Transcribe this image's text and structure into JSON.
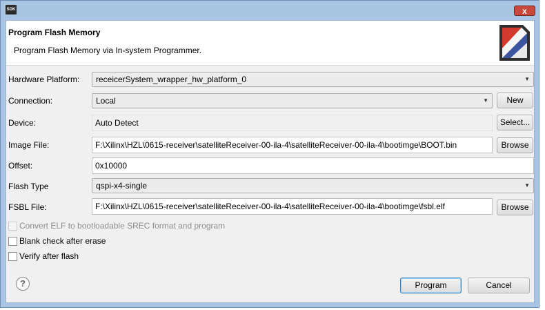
{
  "window": {
    "icon_text": "SDK",
    "close_glyph": "x"
  },
  "banner": {
    "title": "Program Flash Memory",
    "description": "Program Flash Memory via In-system Programmer."
  },
  "form": {
    "hardware_platform": {
      "label": "Hardware Platform:",
      "value": "receicerSystem_wrapper_hw_platform_0"
    },
    "connection": {
      "label": "Connection:",
      "value": "Local",
      "new_button": "New"
    },
    "device": {
      "label": "Device:",
      "value": "Auto Detect",
      "select_button": "Select..."
    },
    "image_file": {
      "label": "Image File:",
      "value": "F:\\Xilinx\\HZL\\0615-receiver\\satelliteReceiver-00-ila-4\\satelliteReceiver-00-ila-4\\bootimge\\BOOT.bin",
      "browse_button": "Browse"
    },
    "offset": {
      "label": "Offset:",
      "value": "0x10000"
    },
    "flash_type": {
      "label": "Flash Type",
      "value": "qspi-x4-single"
    },
    "fsbl_file": {
      "label": "FSBL File:",
      "value": "F:\\Xilinx\\HZL\\0615-receiver\\satelliteReceiver-00-ila-4\\satelliteReceiver-00-ila-4\\bootimge\\fsbl.elf",
      "browse_button": "Browse"
    }
  },
  "checkboxes": {
    "convert_elf": {
      "label": "Convert ELF to bootloadable SREC format and program",
      "checked": false,
      "enabled": false
    },
    "blank_check": {
      "label": "Blank check after erase",
      "checked": false,
      "enabled": true
    },
    "verify": {
      "label": "Verify after flash",
      "checked": false,
      "enabled": true
    }
  },
  "footer": {
    "help_glyph": "?",
    "program_button": "Program",
    "cancel_button": "Cancel"
  },
  "colors": {
    "frame": "#a9c5e4",
    "content_bg": "#f0f0f0",
    "primary_border": "#3c7fb1"
  }
}
